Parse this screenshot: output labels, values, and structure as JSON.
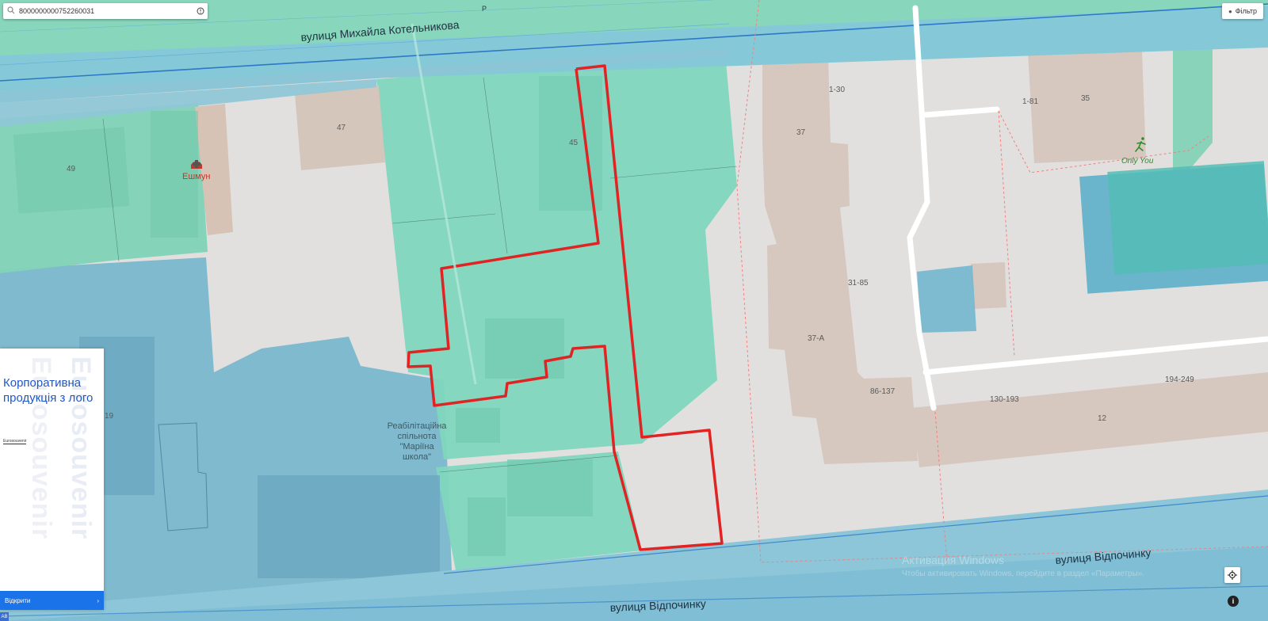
{
  "search": {
    "value": "8000000000752260031"
  },
  "filter": {
    "label": "Фільтр"
  },
  "streets": {
    "top": "вулиця Михайла Котельникова",
    "bottom_right": "вулиця Відпочинку",
    "bottom_left": "вулиця Відпочинку",
    "marker_p": "P"
  },
  "house_numbers": {
    "n49": "49",
    "n47": "47",
    "n45": "45",
    "n37": "37",
    "n35": "35",
    "n19": "19",
    "n12": "12",
    "n37a": "37-А",
    "r1_30": "1-30",
    "r1_81": "1-81",
    "r31_85": "31-85",
    "r86_137": "86-137",
    "r130_193": "130-193",
    "r194_249": "194-249"
  },
  "pois": {
    "eshmun": "Ешмун",
    "only_you": "Only You",
    "rehab_lines": [
      "Реабілітаційна",
      "спільнота",
      "\"Маріїна",
      "школа\""
    ]
  },
  "ad": {
    "title": "Корпоративна продукція з лого",
    "brand": "Eurosouvenir",
    "watermark": "Eurosouvenir",
    "footer_label": "Відкрити",
    "footer_arrow": "›"
  },
  "windows_watermark": {
    "line1": "Активация Windows",
    "line2": "Чтобы активировать Windows, перейдите в раздел «Параметры»."
  },
  "corner_badge": "AB",
  "info_label": "i",
  "icons": {
    "search": "search-icon",
    "clear": "clear-icon",
    "filter": "filter-icon",
    "locate": "crosshair-icon",
    "info": "info-icon",
    "pharmacy": "pharmacy-icon",
    "fitness": "running-person-icon"
  },
  "colors": {
    "parcel_fill": "#7fd6bd",
    "selected_outline": "#e02424",
    "street_band": "#8fc8d9",
    "building": "#d9c8bd",
    "water_zone": "#6db5cf"
  }
}
